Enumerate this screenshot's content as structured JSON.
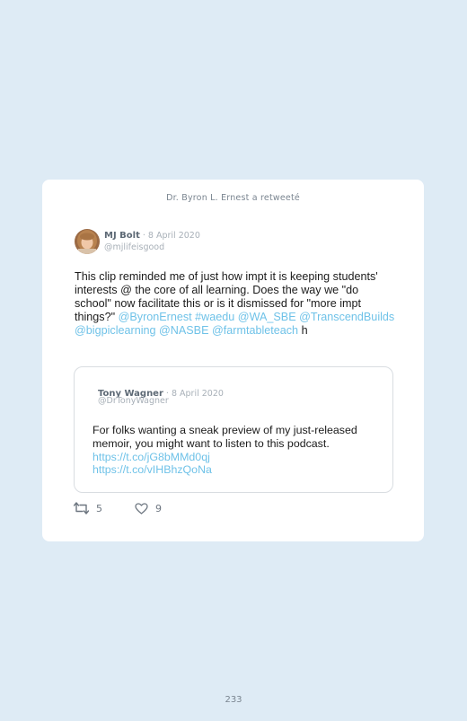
{
  "retweet_notice": "Dr. Byron L. Ernest a retweeté",
  "tweet": {
    "author_name": "MJ Bolt",
    "date": " · 8 April 2020",
    "handle": "@mjlifeisgood",
    "text_main": "This clip reminded me of just how impt it is keeping students' interests @ the core of all learning. Does the way we \"do school\" now facilitate this or is it dismissed for \"more impt things?\"",
    "mentions": "@ByronErnest #waedu @WA_SBE @TranscendBuilds @bigpiclearning @NASBE @farmtableteach",
    "trailing": "h"
  },
  "quoted_tweet": {
    "author_name": "Tony Wagner",
    "date": " · 8 April 2020",
    "handle": "@DrTonyWagner",
    "text": "For folks wanting a sneak preview of my just-released memoir, you might want to listen to this podcast.",
    "link1": "https://t.co/jG8bMMd0qj",
    "link2": "https://t.co/vIHBhzQoNa"
  },
  "actions": {
    "retweet_count": "5",
    "like_count": "9"
  },
  "page_number": "233",
  "colors": {
    "background": "#deebf5",
    "link": "#6fc2e8",
    "muted": "#a8b0b8"
  },
  "icons": [
    "retweet-icon",
    "heart-icon"
  ]
}
